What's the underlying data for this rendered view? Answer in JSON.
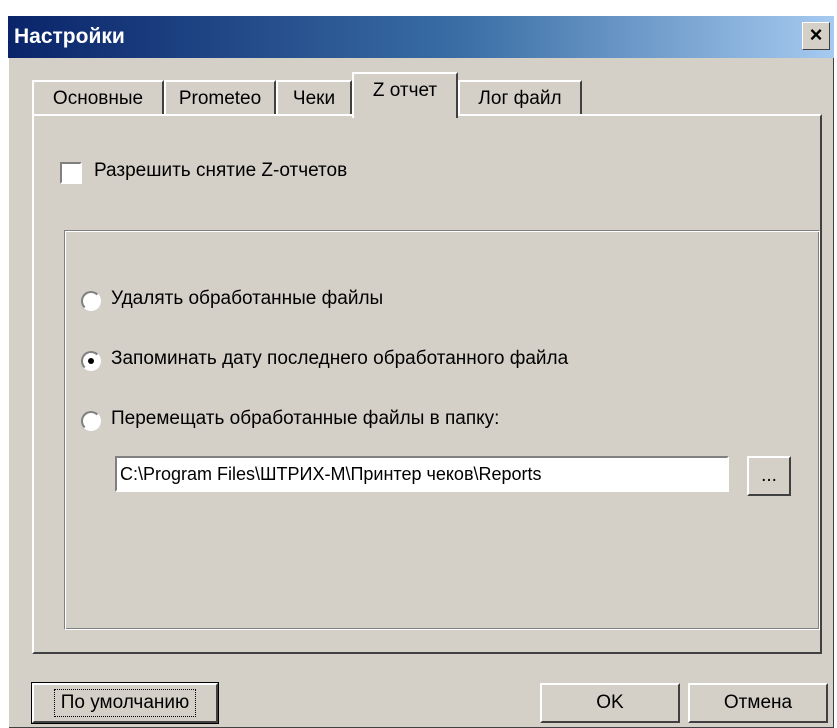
{
  "window": {
    "title": "Настройки",
    "close_label": "✕"
  },
  "tabs": [
    {
      "label": "Основные",
      "active": false
    },
    {
      "label": "Prometeo",
      "active": false
    },
    {
      "label": "Чеки",
      "active": false
    },
    {
      "label": "Z отчет",
      "active": true
    },
    {
      "label": "Лог файл",
      "active": false
    }
  ],
  "z_report": {
    "allow_checkbox_label": "Разрешить снятие Z-отчетов",
    "allow_checked": false,
    "options": [
      {
        "label": "Удалять обработанные файлы",
        "selected": false
      },
      {
        "label": "Запоминать дату последнего обработанного файла",
        "selected": true
      },
      {
        "label": "Перемещать обработанные файлы в папку:",
        "selected": false
      }
    ],
    "folder_path": "C:\\Program Files\\ШТРИХ-М\\Принтер чеков\\Reports",
    "browse_label": "..."
  },
  "footer": {
    "default_label": "По умолчанию",
    "ok_label": "OK",
    "cancel_label": "Отмена"
  }
}
